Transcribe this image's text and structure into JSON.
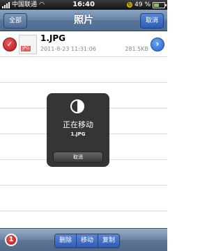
{
  "status_bar": {
    "carrier": "中国联通",
    "time": "16:40",
    "battery": "49 %",
    "battery_level": 0.49
  },
  "nav": {
    "left_button": "全部",
    "title": "照片",
    "right_button": "取消"
  },
  "file": {
    "name": "1.JPG",
    "type_tag": "JPG",
    "date": "2011-8-23 11:31:06",
    "size": "281.5KB"
  },
  "hud": {
    "title": "正在移动",
    "file": "1.JPG",
    "cancel": "取消"
  },
  "toolbar": {
    "badge": "1",
    "delete": "删除",
    "move": "移动",
    "copy": "复制"
  }
}
